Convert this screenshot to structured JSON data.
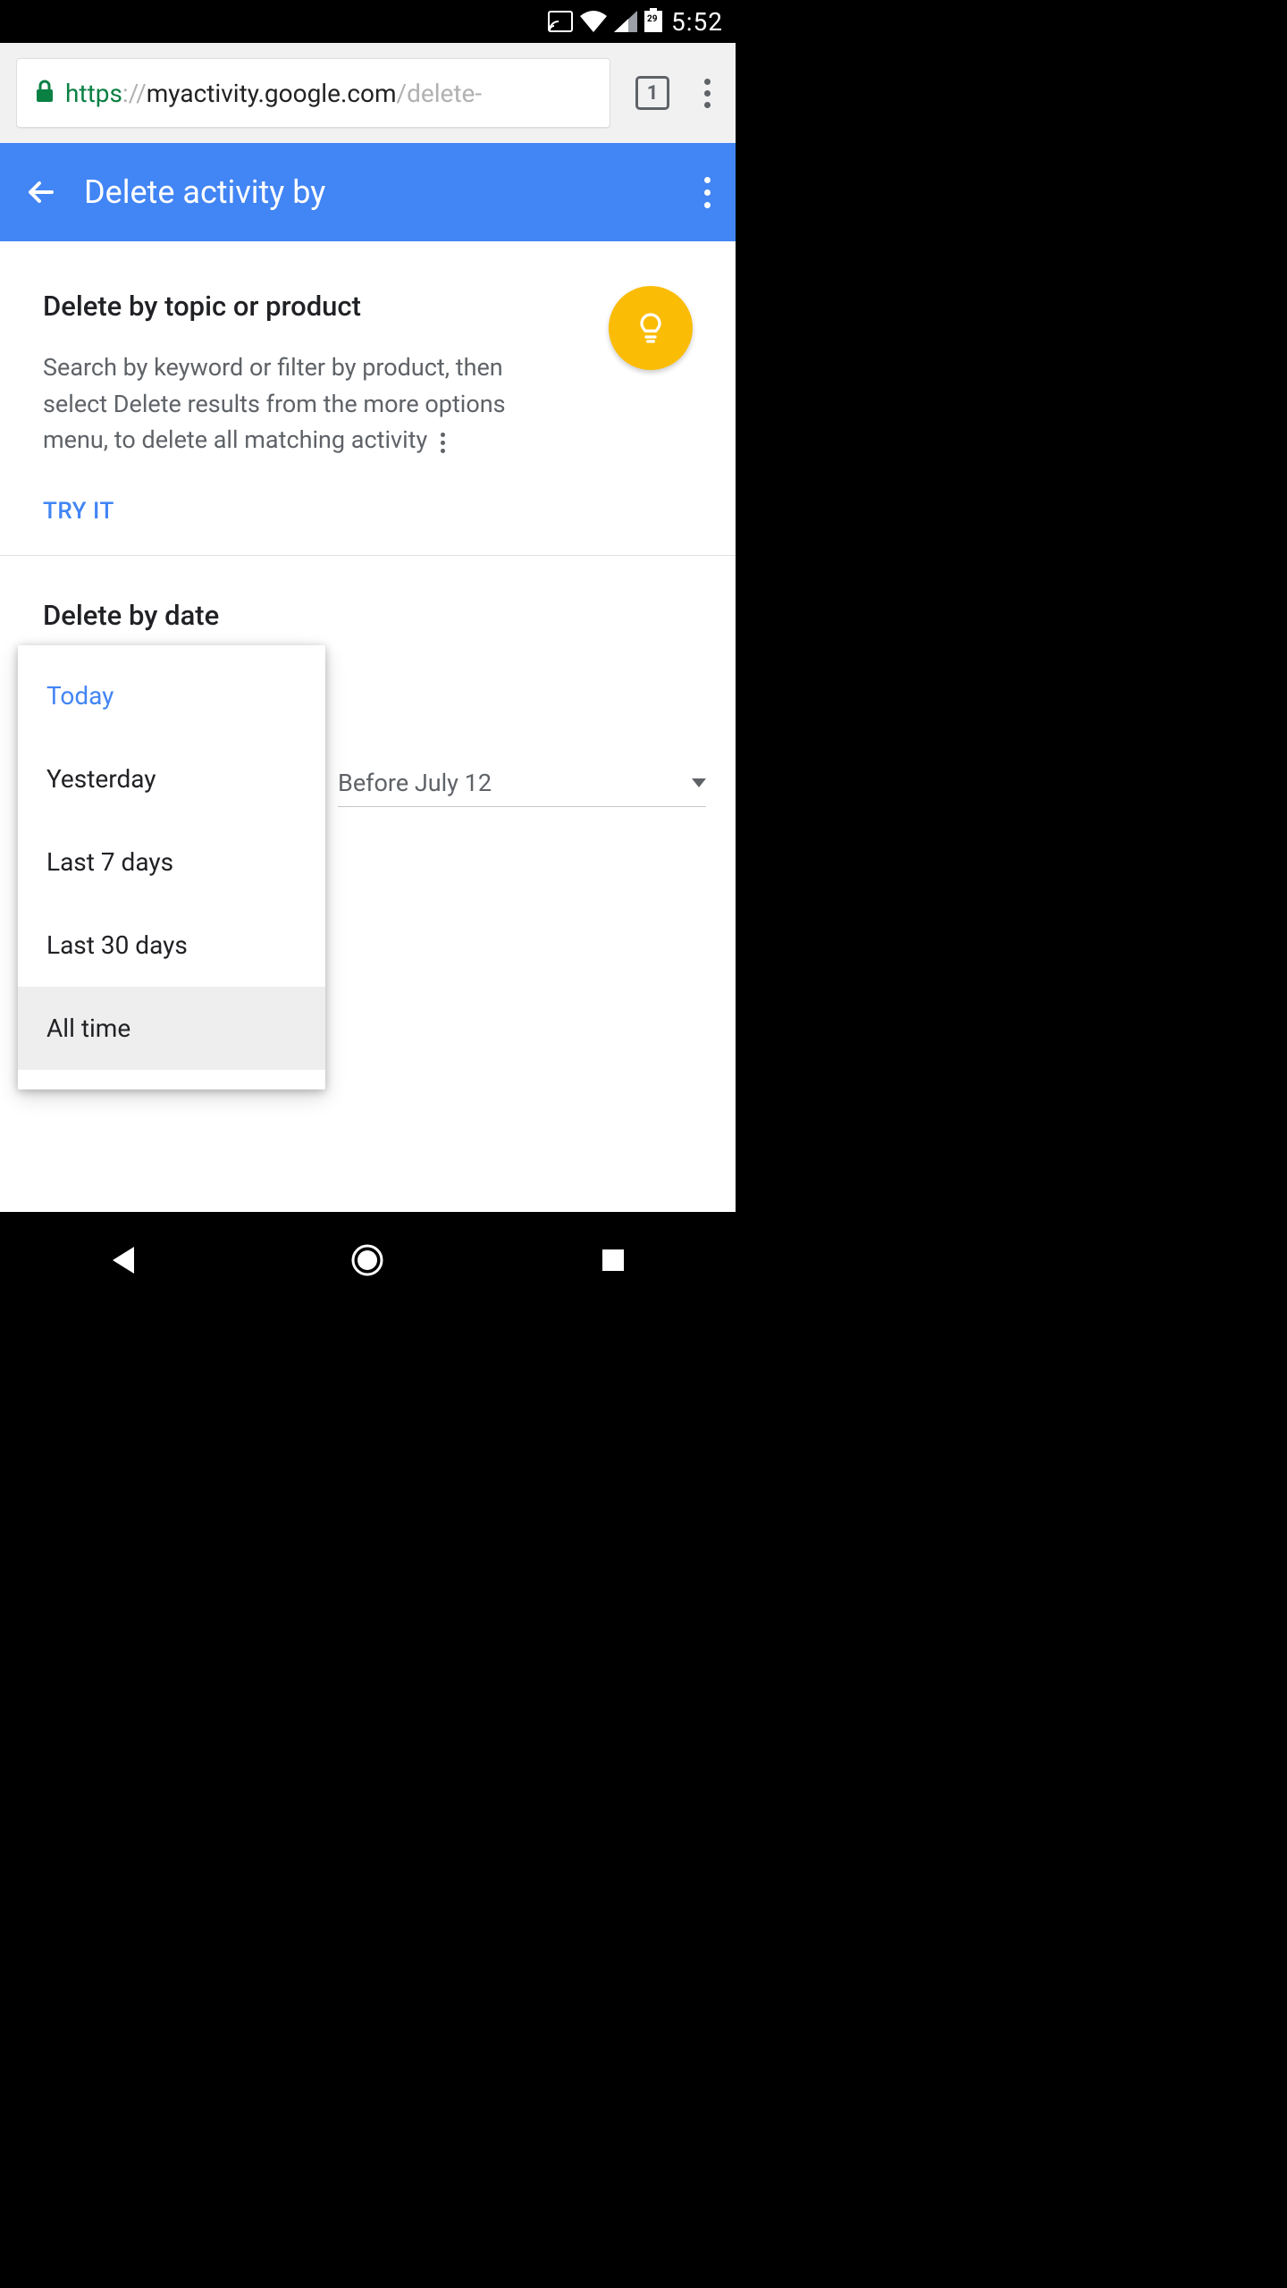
{
  "status": {
    "time": "5:52",
    "battery_level": "29"
  },
  "browser": {
    "url_scheme": "https",
    "url_sep": "://",
    "url_host": "myactivity.google.com",
    "url_path": "/delete-",
    "tab_count": "1"
  },
  "app_bar": {
    "title": "Delete activity by"
  },
  "topic_section": {
    "heading": "Delete by topic or product",
    "body": "Search by keyword or filter by product, then select Delete results from the more options menu, to delete all matching activity",
    "try_it_label": "TRY IT"
  },
  "date_section": {
    "heading": "Delete by date",
    "before_select_label": "Before July 12",
    "options": {
      "0": "Today",
      "1": "Yesterday",
      "2": "Last 7 days",
      "3": "Last 30 days",
      "4": "All time"
    }
  }
}
